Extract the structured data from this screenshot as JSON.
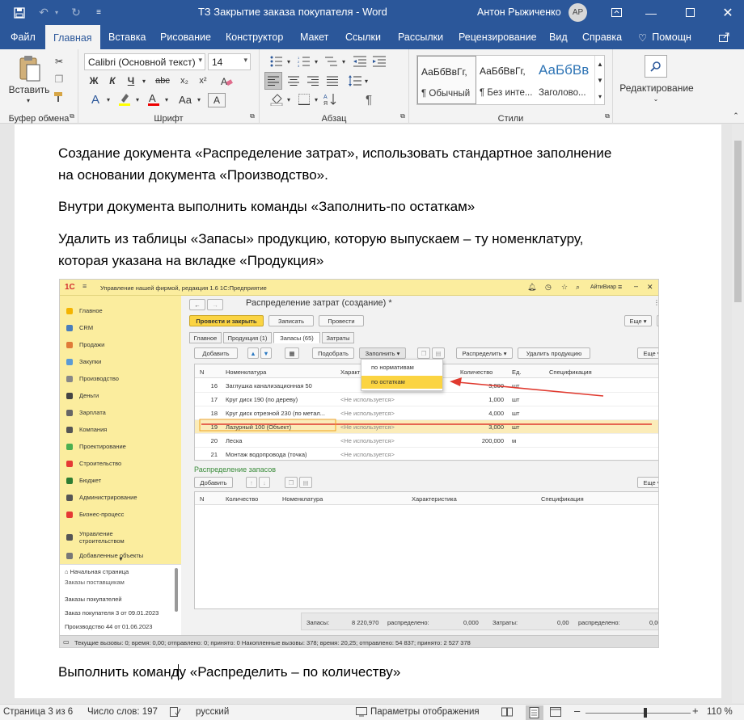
{
  "window": {
    "title": "ТЗ Закрытие заказа покупателя  -  Word",
    "user": "Антон Рыжиченко",
    "avatar": "АР"
  },
  "tabs": [
    "Файл",
    "Главная",
    "Вставка",
    "Рисование",
    "Конструктор",
    "Макет",
    "Ссылки",
    "Рассылки",
    "Рецензирование",
    "Вид",
    "Справка",
    "Помощн"
  ],
  "ribbon": {
    "paste_label": "Вставить",
    "font_name": "Calibri (Основной текст)",
    "font_size": "14",
    "bold": "Ж",
    "italic": "К",
    "underline": "Ч",
    "strike": "abc",
    "sub": "x₂",
    "sup": "x²",
    "aa": "Aa",
    "clear": "A",
    "styles": [
      {
        "sample": "АаБбВвГг,",
        "name": "¶ Обычный"
      },
      {
        "sample": "АаБбВвГг,",
        "name": "¶ Без инте..."
      },
      {
        "sample": "АаБбВв",
        "name": "Заголово..."
      }
    ],
    "editing": "Редактирование",
    "groups": {
      "clipboard": "Буфер обмена",
      "font": "Шрифт",
      "paragraph": "Абзац",
      "styles": "Стили"
    }
  },
  "document": {
    "p1": "Создание документа «Распределение затрат», использовать стандартное заполнение",
    "p1b": "на основании документа «Производство».",
    "p2": "Внутри документа выполнить команды «Заполнить-по остаткам»",
    "p3": "Удалить из таблицы «Запасы» продукцию, которую выпускаем – ту номенклатуру,",
    "p3b": "которая указана на вкладке «Продукция»",
    "p4": "Выполнить команду «Распределить – по количеству»"
  },
  "shot": {
    "app_title": "Управление нашей фирмой, редакция 1.6 1С:Предприятие",
    "user": "АйтиВиар",
    "sidebar": [
      "Главное",
      "CRM",
      "Продажи",
      "Закупки",
      "Производство",
      "Деньги",
      "Зарплата",
      "Компания",
      "Проектирование",
      "Строительство",
      "Бюджет",
      "Администрирование",
      "Бизнес-процесс",
      "Управление строительством",
      "Добавленные объекты"
    ],
    "nav": [
      "Начальная страница",
      "Заказы поставщикам",
      "Заказы покупателей",
      "Заказ покупателя 3 от 09.01.2023",
      "Производство 44 от 01.06.2023"
    ],
    "doc_title": "Распределение затрат (создание) *",
    "btn_post_close": "Провести и закрыть",
    "btn_save": "Записать",
    "btn_post": "Провести",
    "more": "Еще",
    "help": "?",
    "subtabs": [
      "Главное",
      "Продукция (1)",
      "Запасы (65)",
      "Затраты"
    ],
    "btn_add": "Добавить",
    "btn_pick": "Подобрать",
    "btn_fill": "Заполнить",
    "btn_distribute": "Распределить",
    "btn_remove_products": "Удалить продукцию",
    "dropdown": [
      "по нормативам",
      "по остаткам"
    ],
    "columns": [
      "N",
      "Номенклатура",
      "Характ",
      "Количество",
      "Ед.",
      "Спецификация"
    ],
    "rows": [
      {
        "n": "16",
        "name": "Заглушка канализационная 50",
        "char": "",
        "qty": "3,000",
        "unit": "шт"
      },
      {
        "n": "17",
        "name": "Круг диск 190 (по дереву)",
        "char": "<Не используется>",
        "qty": "1,000",
        "unit": "шт"
      },
      {
        "n": "18",
        "name": "Круг диск отрезной 230 (по метал...",
        "char": "<Не используется>",
        "qty": "4,000",
        "unit": "шт"
      },
      {
        "n": "19",
        "name": "Лазурный 100 (Объект)",
        "char": "<Не используется>",
        "qty": "3,000",
        "unit": "шт"
      },
      {
        "n": "20",
        "name": "Леска",
        "char": "<Не используется>",
        "qty": "200,000",
        "unit": "м"
      },
      {
        "n": "21",
        "name": "Монтаж водопровода (точка)",
        "char": "<Не используется>",
        "qty": "",
        "unit": ""
      }
    ],
    "dist_title": "Распределение запасов",
    "dist_columns": [
      "N",
      "Количество",
      "Номенклатура",
      "Характеристика",
      "Спецификация"
    ],
    "footer": {
      "stock_label": "Запасы:",
      "stock_value": "8 220,970",
      "distributed_label": "распределено:",
      "distributed_value": "0,000",
      "costs_label": "Затраты:",
      "costs_value": "0,00",
      "costs_dist_label": "распределено:",
      "costs_dist_value": "0,00"
    },
    "status": "Текущие вызовы: 0; время: 0,00; отправлено: 0; принято: 0    Накопленные вызовы: 378; время: 20,25; отправлено: 54 837; принято: 2 527 378"
  },
  "statusbar": {
    "page": "Страница 3 из 6",
    "words": "Число слов: 197",
    "lang": "русский",
    "display": "Параметры отображения",
    "zoom": "110 %"
  },
  "colors": {
    "word_blue": "#2b579a",
    "onec_yellow": "#fbed9e",
    "arrow_red": "#e03a2f"
  }
}
